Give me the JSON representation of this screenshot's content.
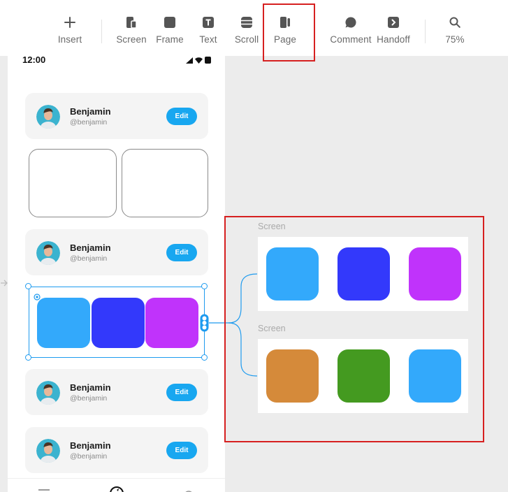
{
  "toolbar": {
    "items": [
      {
        "name": "insert",
        "label": "Insert",
        "icon": "plus-icon"
      },
      {
        "name": "screen",
        "label": "Screen",
        "icon": "screen-icon"
      },
      {
        "name": "frame",
        "label": "Frame",
        "icon": "frame-icon"
      },
      {
        "name": "text",
        "label": "Text",
        "icon": "text-icon"
      },
      {
        "name": "scroll",
        "label": "Scroll",
        "icon": "scroll-icon"
      },
      {
        "name": "page",
        "label": "Page",
        "icon": "page-icon"
      },
      {
        "name": "comment",
        "label": "Comment",
        "icon": "comment-icon"
      },
      {
        "name": "handoff",
        "label": "Handoff",
        "icon": "handoff-icon"
      },
      {
        "name": "zoom",
        "label": "75%",
        "icon": "search-icon"
      }
    ]
  },
  "phone": {
    "status_time": "12:00",
    "cards": [
      {
        "name": "Benjamin",
        "handle": "@benjamin",
        "edit": "Edit"
      },
      {
        "name": "Benjamin",
        "handle": "@benjamin",
        "edit": "Edit"
      },
      {
        "name": "Benjamin",
        "handle": "@benjamin",
        "edit": "Edit"
      },
      {
        "name": "Benjamin",
        "handle": "@benjamin",
        "edit": "Edit"
      }
    ],
    "selected_row_colors": [
      "#33a9fb",
      "#3339fb",
      "#c033fb"
    ]
  },
  "screens": [
    {
      "label": "Screen",
      "colors": [
        "#33a9fb",
        "#3339fb",
        "#c033fb"
      ]
    },
    {
      "label": "Screen",
      "colors": [
        "#d58a3a",
        "#449a20",
        "#33a9fb"
      ]
    }
  ],
  "colors": {
    "accent": "#18a7f0",
    "selection": "#1e9bef",
    "highlight": "#d62020"
  }
}
